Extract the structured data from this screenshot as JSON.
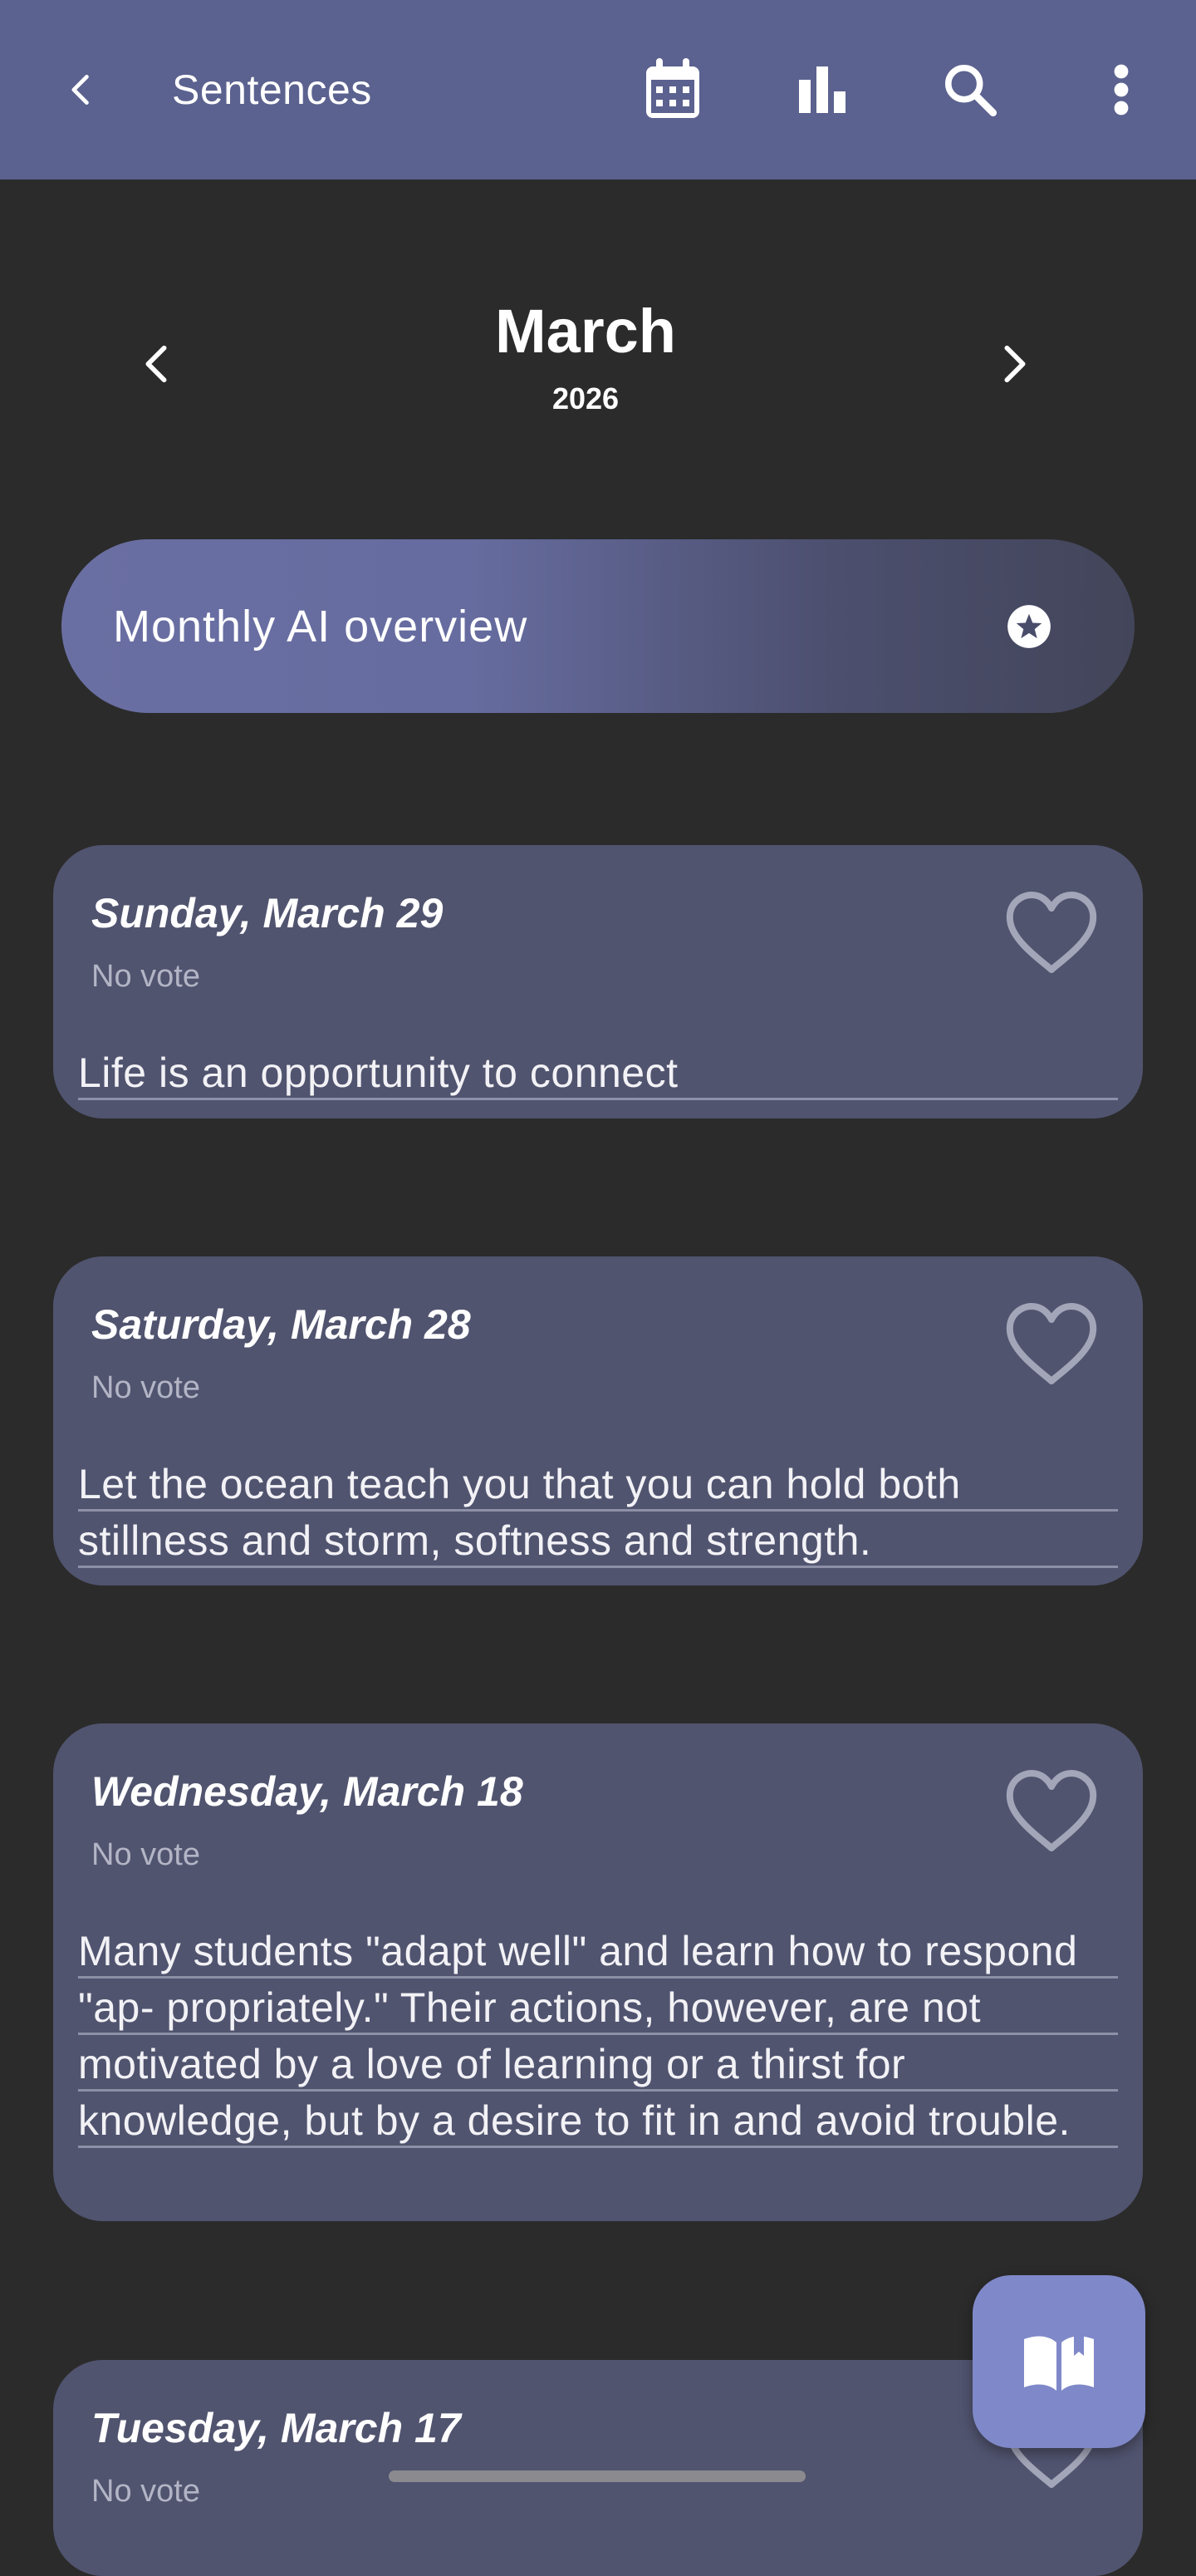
{
  "appbar": {
    "title": "Sentences",
    "icons": {
      "back": "back-arrow-icon",
      "calendar": "calendar-icon",
      "stats": "bar-chart-icon",
      "search": "search-icon",
      "more": "more-vert-icon"
    }
  },
  "month_nav": {
    "month": "March",
    "year": "2026"
  },
  "ai_overview": {
    "label": "Monthly AI overview",
    "icon": "star-circle-icon"
  },
  "entries": [
    {
      "date": "Sunday, March 29",
      "vote": "No vote",
      "sentence": "Life is an opportunity to connect"
    },
    {
      "date": "Saturday, March 28",
      "vote": "No vote",
      "sentence": "Let the ocean teach you that you can hold both stillness and storm, softness and strength."
    },
    {
      "date": "Wednesday, March 18",
      "vote": "No vote",
      "sentence": "Many students \"adapt well\" and learn how to respond \"ap- propriately.\" Their actions, however, are not motivated by a love of learning or a thirst for knowledge, but by a desire to fit in and avoid trouble."
    },
    {
      "date": "Tuesday, March 17",
      "vote": "No vote",
      "sentence": ""
    }
  ],
  "fab": {
    "icon": "open-book-icon"
  },
  "colors": {
    "appbar": "#5b628f",
    "background": "#2b2b2b",
    "card": "#51546f",
    "fab": "#7f88c8"
  }
}
